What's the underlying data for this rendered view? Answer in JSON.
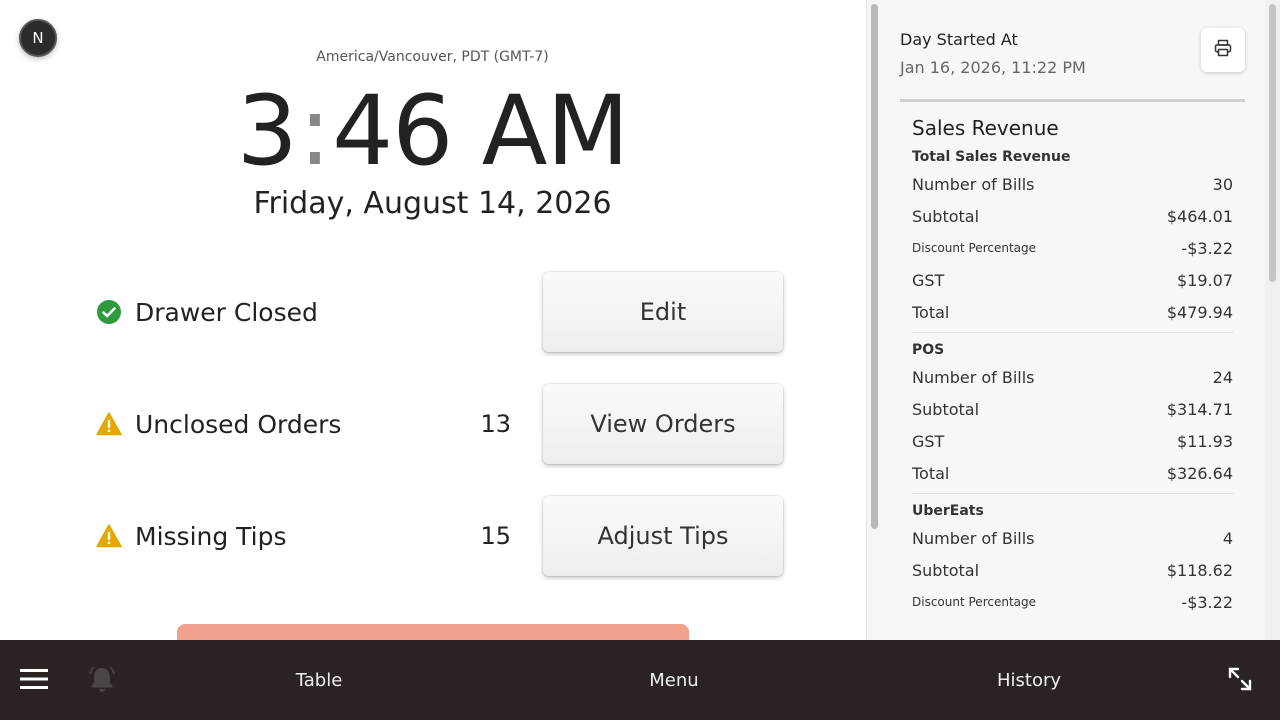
{
  "header": {
    "avatar_letter": "N",
    "timezone": "America/Vancouver, PDT (GMT-7)",
    "time_hour": "3",
    "time_colon": ":",
    "time_rest": "46 AM",
    "date": "Friday, August 14, 2026"
  },
  "status_rows": [
    {
      "label": "Drawer Closed",
      "count": "",
      "button": "Edit",
      "status": "ok",
      "icon": "check-circle-icon"
    },
    {
      "label": "Unclosed Orders",
      "count": "13",
      "button": "View Orders",
      "status": "warning",
      "icon": "warning-icon"
    },
    {
      "label": "Missing Tips",
      "count": "15",
      "button": "Adjust Tips",
      "status": "warning",
      "icon": "warning-icon"
    }
  ],
  "colors": {
    "ok": "#2e9a3c",
    "warning": "#e5a800",
    "accent_button": "#f1a28f",
    "bottom_bar": "#2a2321"
  },
  "summary": {
    "day_started_label": "Day Started At",
    "day_started_value": "Jan 16, 2026, 11:22 PM",
    "title": "Sales Revenue",
    "sections": [
      {
        "name": "Total Sales Revenue",
        "rows": [
          {
            "k": "Number of Bills",
            "v": "30"
          },
          {
            "k": "Subtotal",
            "v": "$464.01"
          },
          {
            "k": "Discount Percentage",
            "v": "-$3.22"
          },
          {
            "k": "GST",
            "v": "$19.07"
          },
          {
            "k": "Total",
            "v": "$479.94"
          }
        ]
      },
      {
        "name": "POS",
        "rows": [
          {
            "k": "Number of Bills",
            "v": "24"
          },
          {
            "k": "Subtotal",
            "v": "$314.71"
          },
          {
            "k": "GST",
            "v": "$11.93"
          },
          {
            "k": "Total",
            "v": "$326.64"
          }
        ]
      },
      {
        "name": "UberEats",
        "rows": [
          {
            "k": "Number of Bills",
            "v": "4"
          },
          {
            "k": "Subtotal",
            "v": "$118.62"
          },
          {
            "k": "Discount Percentage",
            "v": "-$3.22"
          }
        ]
      }
    ]
  },
  "nav": {
    "table": "Table",
    "menu": "Menu",
    "history": "History"
  }
}
